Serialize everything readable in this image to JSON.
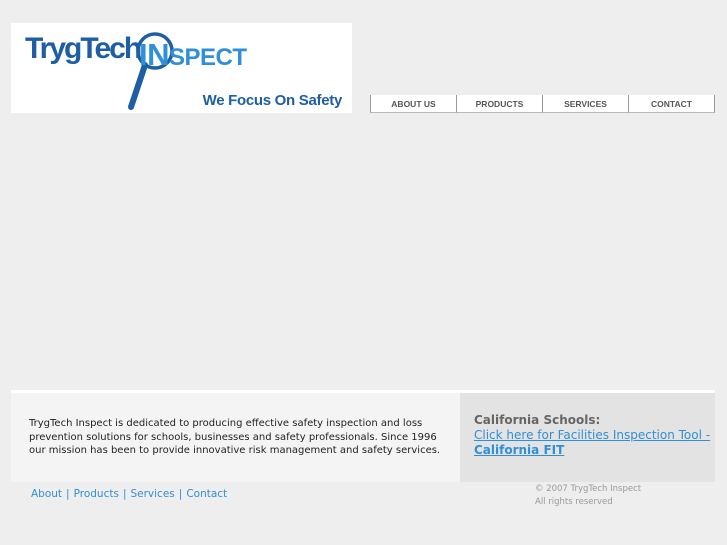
{
  "header": {
    "logo_tryg": "TrygTech",
    "logo_in": "IN",
    "logo_spect": "SPECT",
    "tagline": "We Focus On Safety"
  },
  "nav": {
    "items": [
      {
        "label": "ABOUT US"
      },
      {
        "label": "PRODUCTS"
      },
      {
        "label": "SERVICES"
      },
      {
        "label": "CONTACT"
      }
    ]
  },
  "footer": {
    "mission": "TrygTech Inspect is dedicated to producing effective safety inspection and loss prevention solutions for schools, businesses and safety professionals. Since 1996 our mission has been to provide innovative risk management and safety services.",
    "california_title": "California Schools:",
    "california_link": "Click here for Facilities Inspection Tool -",
    "california_fit": "California FIT",
    "links": [
      "About",
      "Products",
      "Services",
      "Contact"
    ],
    "separator": "|",
    "copyright_line1": "© 2007 TrygTech Inspect",
    "copyright_line2": "All rights reserved"
  },
  "colors": {
    "background": "#eeeeee",
    "brand_dark_blue": "#1e5fa3",
    "brand_light_blue": "#2f8fd8",
    "link": "#2f8fd8"
  },
  "icons": [
    "magnifier-icon"
  ]
}
